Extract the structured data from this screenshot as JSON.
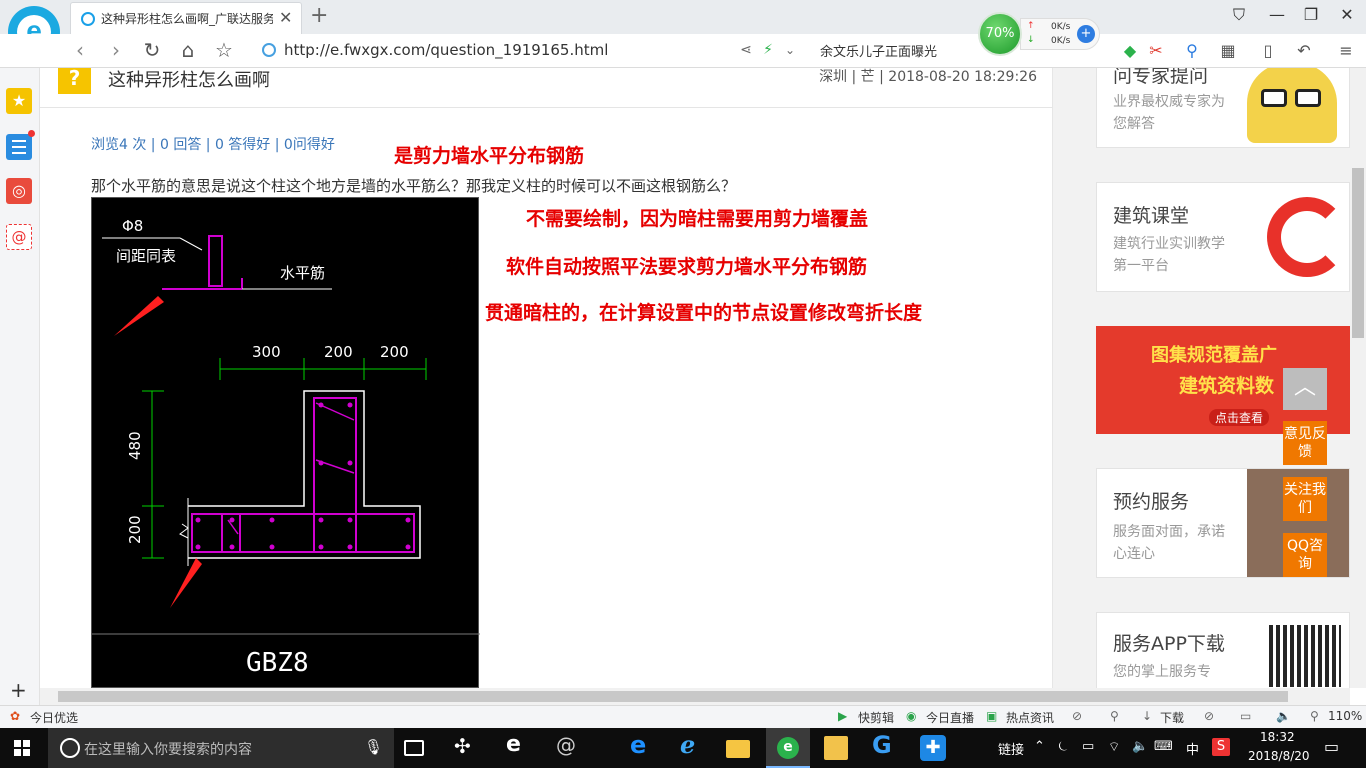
{
  "browser": {
    "tab_title": "这种异形柱怎么画啊_广联达服务新",
    "url": "http://e.fwxgx.com/question_1919165.html",
    "hot_word": "余文乐儿子正面曝光",
    "speed": {
      "percent": "70%",
      "up": "0K/s",
      "down": "0K/s"
    }
  },
  "question": {
    "title": "这种异形柱怎么画啊",
    "meta": "深圳 | 芒 | 2018-08-20 18:29:26",
    "stats": "浏览4 次 | 0 回答 | 0 答得好 | 0问得好",
    "text": "那个水平筋的意思是说这个柱这个地方是墙的水平筋么？那我定义柱的时候可以不画这根钢筋么？"
  },
  "annotations": [
    "是剪力墙水平分布钢筋",
    "不需要绘制，因为暗柱需要用剪力墙覆盖",
    "软件自动按照平法要求剪力墙水平分布钢筋",
    "贯通暗柱的，在计算设置中的节点设置修改弯折长度"
  ],
  "cad": {
    "rebar_label": "Φ8",
    "spacing_label": "间距同表",
    "horizontal_label": "水平筋",
    "dims_top": [
      "300",
      "200",
      "200"
    ],
    "dim_left_top": "480",
    "dim_left_bottom": "200",
    "name": "GBZ8",
    "colors": {
      "rebar": "#d000d0",
      "dim": "#00d000",
      "outline": "#ffffff",
      "arrow": "#ff2020"
    }
  },
  "sidebar_cards": [
    {
      "title": "问专家提问",
      "sub": "业界最权威专家为您解答"
    },
    {
      "title": "建筑课堂",
      "sub": "建筑行业实训教学第一平台"
    },
    {
      "title": "图集规范覆盖广",
      "sub": "建筑资料数",
      "cta": "点击查看"
    },
    {
      "title": "预约服务",
      "sub": "服务面对面，承诺心连心"
    },
    {
      "title": "服务APP下载",
      "sub": "您的掌上服务专"
    }
  ],
  "float_buttons": [
    "意见反馈",
    "关注我们",
    "QQ咨询"
  ],
  "statusbar": {
    "left": "今日优选",
    "items": [
      "快剪辑",
      "今日直播",
      "热点资讯"
    ],
    "download": "下载",
    "zoom": "110%"
  },
  "taskbar": {
    "search_placeholder": "在这里输入你要搜索的内容",
    "tray_text": "链接",
    "ime": "中",
    "time": "18:32",
    "date": "2018/8/20"
  }
}
